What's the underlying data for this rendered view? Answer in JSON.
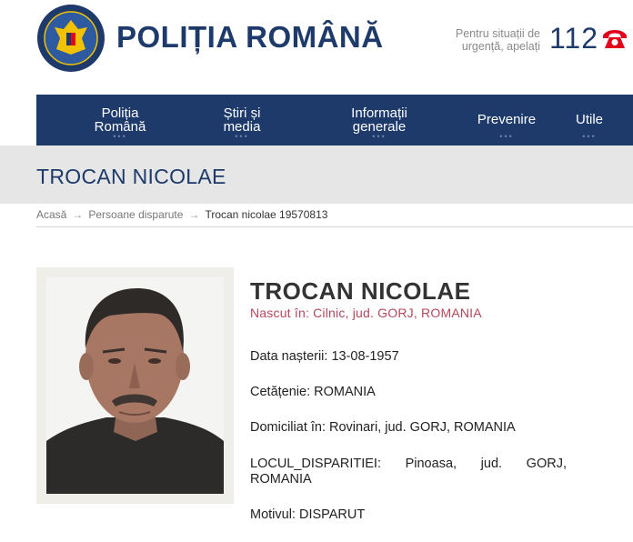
{
  "header": {
    "site_title": "POLIȚIA ROMÂNĂ",
    "emergency_text": "Pentru situații de urgență, apelați",
    "emergency_number": "112",
    "logo_icon": "police-crest-icon",
    "phone_icon": "phone-icon",
    "brand_color": "#1d3a6b",
    "accent_color": "#e2001a"
  },
  "nav": {
    "items": [
      {
        "label_line1": "Poliția",
        "label_line2": "Română"
      },
      {
        "label_line1": "Știri și",
        "label_line2": "media"
      },
      {
        "label_line1": "Informații",
        "label_line2": "generale"
      },
      {
        "label": "Prevenire"
      },
      {
        "label": "Utile"
      }
    ],
    "dots": "•••"
  },
  "page": {
    "title": "TROCAN NICOLAE"
  },
  "breadcrumb": {
    "items": [
      "Acasă",
      "Persoane disparute"
    ],
    "current": "Trocan nicolae 19570813",
    "separator": "→"
  },
  "person": {
    "name": "TROCAN NICOLAE",
    "birth_place": "Nascut în: Cilnic, jud. GORJ, ROMANIA",
    "birth_date": "Data nașterii: 13-08-1957",
    "citizenship": "Cetățenie: ROMANIA",
    "domicile": "Domiciliat în: Rovinari, jud. GORJ, ROMANIA",
    "disappearance_place_line1": "LOCUL_DISPARITIEI: Pinoasa, jud. GORJ,",
    "disappearance_place_line2": "ROMANIA",
    "reason": "Motivul: DISPARUT"
  }
}
